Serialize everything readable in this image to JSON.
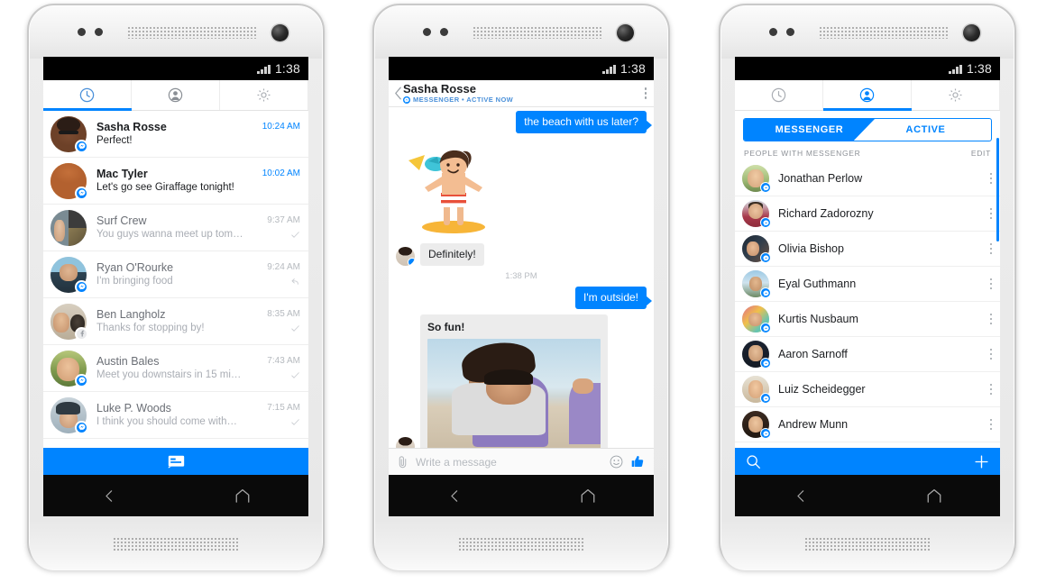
{
  "meta": {
    "scene": "Facebook Messenger for Android — three phone screens",
    "accent_blue": "#0084FF",
    "phone_count": 3
  },
  "status_bar": {
    "time": "1:38",
    "signal_icon": "signal-bars-icon"
  },
  "nav_bar": {
    "back_label": "back-button",
    "home_label": "home-button"
  },
  "phone1": {
    "label": "recent-threads-screen",
    "tabs": [
      {
        "id": "recents",
        "icon": "clock-icon",
        "active": true
      },
      {
        "id": "people",
        "icon": "person-icon",
        "active": false
      },
      {
        "id": "settings",
        "icon": "gear-icon",
        "active": false
      }
    ],
    "threads": [
      {
        "name": "Sasha Rosse",
        "snippet": "Perfect!",
        "time": "10:24 AM",
        "unread": true,
        "badge": "messenger",
        "status": "none",
        "avatar_class": "p-sasha"
      },
      {
        "name": "Mac Tyler",
        "snippet": "Let's go see Giraffage tonight!",
        "time": "10:02 AM",
        "unread": true,
        "badge": "messenger",
        "status": "none",
        "avatar_class": "p-mac"
      },
      {
        "name": "Surf Crew",
        "snippet": "You guys wanna meet up tom…",
        "time": "9:37 AM",
        "unread": false,
        "badge": "none",
        "status": "sent",
        "avatar_class": "p-surf"
      },
      {
        "name": "Ryan O'Rourke",
        "snippet": "I'm bringing food",
        "time": "9:24 AM",
        "unread": false,
        "badge": "messenger",
        "status": "reply",
        "avatar_class": "p-ryan"
      },
      {
        "name": "Ben Langholz",
        "snippet": "Thanks for stopping by!",
        "time": "8:35 AM",
        "unread": false,
        "badge": "facebook",
        "status": "sent",
        "avatar_class": "p-ben"
      },
      {
        "name": "Austin Bales",
        "snippet": "Meet you downstairs in 15 mi…",
        "time": "7:43 AM",
        "unread": false,
        "badge": "messenger",
        "status": "sent",
        "avatar_class": "p-austin"
      },
      {
        "name": "Luke P. Woods",
        "snippet": "I think you should come with…",
        "time": "7:15 AM",
        "unread": false,
        "badge": "messenger",
        "status": "sent",
        "avatar_class": "p-luke"
      }
    ],
    "compose_bar": {
      "icon": "new-message-icon"
    }
  },
  "phone2": {
    "label": "conversation-screen",
    "header": {
      "back_icon": "back-chevron-icon",
      "title": "Sasha Rosse",
      "subtitle": "MESSENGER • ACTIVE NOW",
      "presence_icon": "messenger-badge-icon",
      "menu_icon": "kebab-menu-icon"
    },
    "messages": [
      {
        "type": "text",
        "side": "out",
        "text": "the beach with us later?"
      },
      {
        "type": "sticker",
        "side": "in",
        "name": "surfer-sticker"
      },
      {
        "type": "text",
        "side": "in",
        "text": "Definitely!",
        "avatar_class": "p-sashamini"
      },
      {
        "type": "time",
        "text": "1:38 PM"
      },
      {
        "type": "text",
        "side": "out",
        "text": "I'm outside!"
      },
      {
        "type": "photo",
        "side": "in",
        "caption": "So fun!",
        "avatar_class": "p-sashamini",
        "photo_name": "beach-piggyback-photo"
      }
    ],
    "composer": {
      "attach_icon": "paperclip-icon",
      "placeholder": "Write a message",
      "emoji_icon": "emoji-smiley-icon",
      "like_icon": "thumbs-up-icon"
    }
  },
  "phone3": {
    "label": "people-screen",
    "tabs": [
      {
        "id": "recents",
        "icon": "clock-icon",
        "active": false
      },
      {
        "id": "people",
        "icon": "person-icon",
        "active": true
      },
      {
        "id": "settings",
        "icon": "gear-icon",
        "active": false
      }
    ],
    "segmented": {
      "left": "MESSENGER",
      "right": "ACTIVE",
      "selected": "MESSENGER"
    },
    "section": {
      "title": "PEOPLE WITH MESSENGER",
      "action": "EDIT"
    },
    "people": [
      {
        "name": "Jonathan Perlow",
        "badge": "messenger",
        "avatar_class": "p-jon"
      },
      {
        "name": "Richard Zadorozny",
        "badge": "messenger",
        "avatar_class": "p-rich"
      },
      {
        "name": "Olivia Bishop",
        "badge": "messenger",
        "avatar_class": "p-olivia"
      },
      {
        "name": "Eyal Guthmann",
        "badge": "messenger",
        "avatar_class": "p-eyal"
      },
      {
        "name": "Kurtis Nusbaum",
        "badge": "messenger",
        "avatar_class": "p-kurtis"
      },
      {
        "name": "Aaron Sarnoff",
        "badge": "messenger",
        "avatar_class": "p-aaron"
      },
      {
        "name": "Luiz Scheidegger",
        "badge": "messenger",
        "avatar_class": "p-luiz"
      },
      {
        "name": "Andrew Munn",
        "badge": "messenger",
        "avatar_class": "p-andrew"
      }
    ],
    "bottom_bar": {
      "search_icon": "search-icon",
      "add_icon": "plus-icon"
    }
  }
}
